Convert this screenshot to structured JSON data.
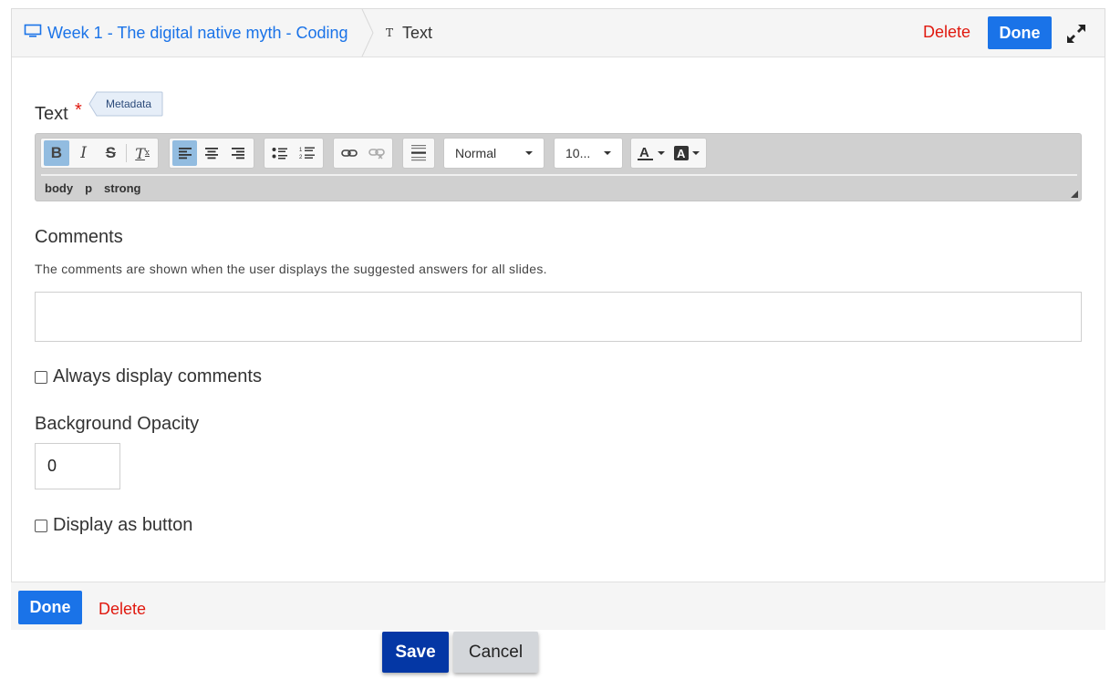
{
  "header": {
    "breadcrumb_icon": "monitor-icon",
    "breadcrumb_link": "Week 1 - The digital native myth - Coding",
    "current_icon": "text-type-icon",
    "current_title": "Text",
    "delete_label": "Delete",
    "done_label": "Done",
    "fullscreen_icon": "expand-icon"
  },
  "text_field": {
    "label": "Text",
    "required_mark": "*",
    "metadata_label": "Metadata",
    "toolbar": {
      "format_buttons": [
        "bold-icon",
        "italic-icon",
        "strikethrough-icon",
        "remove-format-icon"
      ],
      "align_buttons": [
        "align-left-icon",
        "align-center-icon",
        "align-right-icon"
      ],
      "list_buttons": [
        "bulleted-list-icon",
        "numbered-list-icon"
      ],
      "link_buttons": [
        "link-icon",
        "unlink-icon"
      ],
      "block_buttons": [
        "horizontal-rule-icon"
      ],
      "format_select": "Normal",
      "size_select": "10...",
      "color_buttons": [
        "text-color-icon",
        "background-color-icon"
      ]
    },
    "element_path": [
      "body",
      "p",
      "strong"
    ]
  },
  "comments": {
    "label": "Comments",
    "description": "The comments are shown when the user displays the suggested answers for all slides.",
    "value": ""
  },
  "always_display_comments": {
    "label": "Always display comments",
    "checked": false
  },
  "background_opacity": {
    "label": "Background Opacity",
    "value": "0"
  },
  "display_as_button": {
    "label": "Display as button",
    "checked": false
  },
  "footer": {
    "done_label": "Done",
    "delete_label": "Delete"
  },
  "actions": {
    "save_label": "Save",
    "cancel_label": "Cancel"
  },
  "colors": {
    "accent_blue": "#1a73e8",
    "danger_red": "#e0190f",
    "save_blue": "#0437a5"
  }
}
